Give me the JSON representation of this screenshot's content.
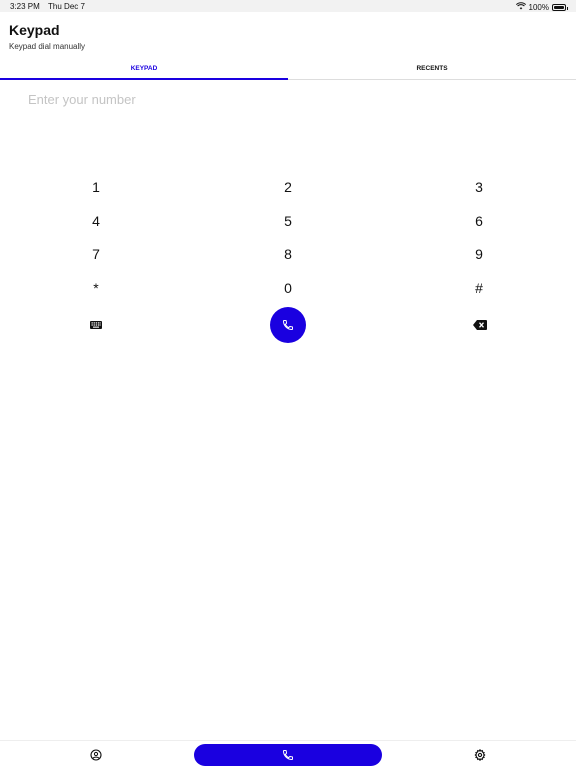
{
  "status_bar": {
    "time": "3:23 PM",
    "date": "Thu Dec 7",
    "battery": "100%",
    "battery_level": 1.0
  },
  "header": {
    "title": "Keypad",
    "subtitle": "Keypad dial manually"
  },
  "tabs": [
    {
      "label": "KEYPAD",
      "active": true
    },
    {
      "label": "RECENTS",
      "active": false
    }
  ],
  "input": {
    "value": "",
    "placeholder": "Enter your number"
  },
  "keypad": {
    "keys": [
      "1",
      "2",
      "3",
      "4",
      "5",
      "6",
      "7",
      "8",
      "9",
      "*",
      "0",
      "#"
    ]
  },
  "actions": {
    "keyboard_icon": "keyboard-icon",
    "call_icon": "phone-icon",
    "backspace_icon": "backspace-icon"
  },
  "bottom_nav": {
    "contacts_icon": "user-circle-icon",
    "dial_icon": "phone-icon",
    "settings_icon": "gear-icon"
  },
  "colors": {
    "accent": "#1a00e0",
    "text": "#111111",
    "placeholder": "#c4c4c4"
  }
}
